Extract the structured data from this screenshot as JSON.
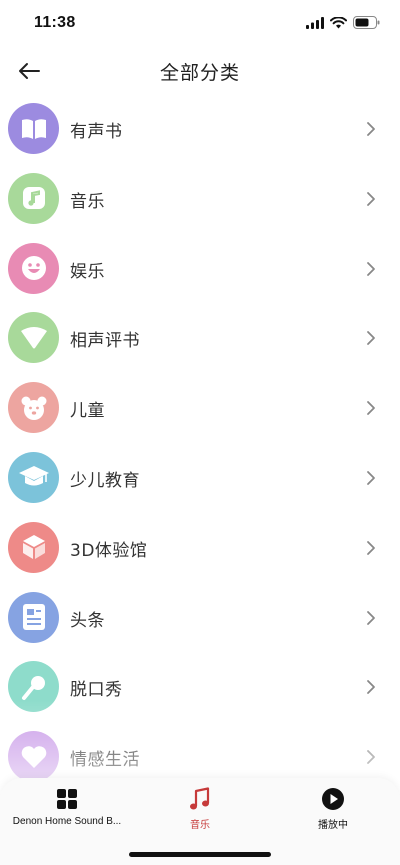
{
  "status": {
    "time": "11:38"
  },
  "header": {
    "title": "全部分类"
  },
  "categories": [
    {
      "label": "有声书",
      "icon": "book-icon",
      "color": "#9C8BE0"
    },
    {
      "label": "音乐",
      "icon": "music-note-icon",
      "color": "#A8D99A"
    },
    {
      "label": "娱乐",
      "icon": "smiley-icon",
      "color": "#E88BB4"
    },
    {
      "label": "相声评书",
      "icon": "fan-icon",
      "color": "#A8D99A"
    },
    {
      "label": "儿童",
      "icon": "bear-icon",
      "color": "#EDA5A0"
    },
    {
      "label": "少儿教育",
      "icon": "graduation-cap-icon",
      "color": "#7CC3DA"
    },
    {
      "label": "3D体验馆",
      "icon": "cube-icon",
      "color": "#EE8A88"
    },
    {
      "label": "头条",
      "icon": "news-icon",
      "color": "#86A3E2"
    },
    {
      "label": "脱口秀",
      "icon": "microphone-icon",
      "color": "#8EDCCB"
    },
    {
      "label": "情感生活",
      "icon": "heart-icon",
      "color": "#C99BE8"
    }
  ],
  "tabbar": {
    "tabs": [
      {
        "label": "Denon Home Sound B...",
        "icon": "grid-icon"
      },
      {
        "label": "音乐",
        "icon": "music-tab-icon",
        "active": true
      },
      {
        "label": "播放中",
        "icon": "play-icon"
      }
    ]
  },
  "colors": {
    "accent": "#C63A3A"
  }
}
